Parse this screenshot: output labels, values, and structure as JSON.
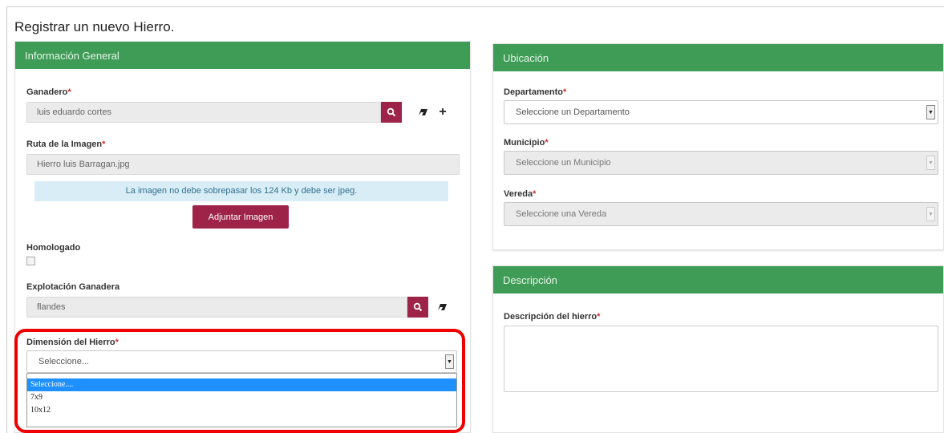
{
  "page": {
    "title": "Registrar un nuevo Hierro."
  },
  "general": {
    "header": "Información General",
    "ganadero": {
      "label": "Ganadero",
      "value": "luis eduardo cortes"
    },
    "ruta": {
      "label": "Ruta de la Imagen",
      "value": "Hierro luis Barragan.jpg"
    },
    "info": "La imagen no debe sobrepasar los 124 Kb y debe ser jpeg.",
    "attach_label": "Adjuntar Imagen",
    "homologado": {
      "label": "Homologado",
      "checked": false
    },
    "explotacion": {
      "label": "Explotación Ganadera",
      "value": "flandes"
    },
    "dimension": {
      "label": "Dimensión del Hierro",
      "value": "Seleccione...",
      "options": [
        "Seleccione....",
        "7x9",
        "10x12"
      ],
      "selected_index": 0
    }
  },
  "ubicacion": {
    "header": "Ubicación",
    "departamento": {
      "label": "Departamento",
      "value": "Seleccione un Departamento"
    },
    "municipio": {
      "label": "Municipio",
      "value": "Seleccione un Municipio"
    },
    "vereda": {
      "label": "Vereda",
      "value": "Seleccione una Vereda"
    }
  },
  "descripcion": {
    "header": "Descripción",
    "label": "Descripción del hierro",
    "value": ""
  },
  "required_mark": "*",
  "icons": {
    "search": "search-icon",
    "eraser": "eraser-icon",
    "add": "plus-icon",
    "dropdown": "chevron-down-icon"
  },
  "colors": {
    "header_green": "#3e9c56",
    "button_maroon": "#9d2348",
    "info_bg": "#d9edf7",
    "highlight": "#ef0000",
    "option_selected": "#1e90ff"
  }
}
